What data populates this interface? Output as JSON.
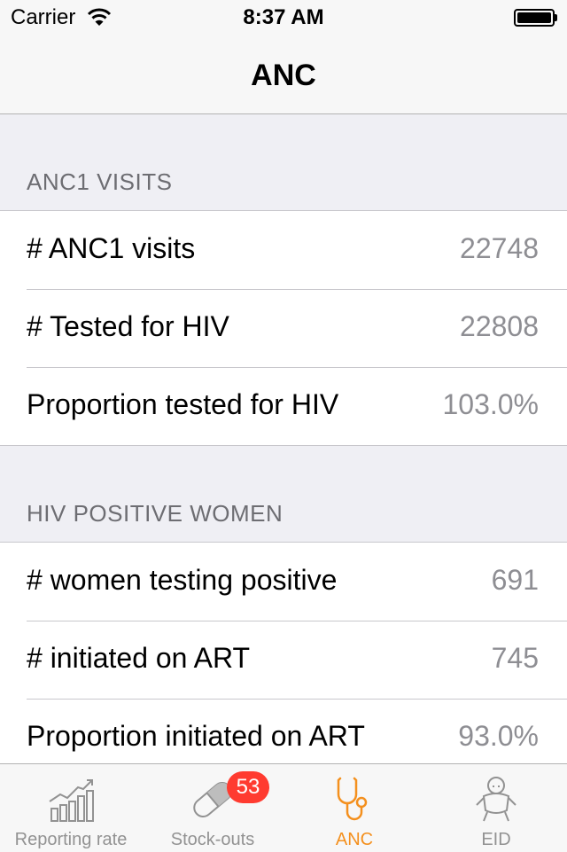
{
  "status_bar": {
    "carrier": "Carrier",
    "time": "8:37 AM"
  },
  "nav": {
    "title": "ANC"
  },
  "sections": [
    {
      "header": "ANC1 VISITS",
      "rows": [
        {
          "label": "# ANC1 visits",
          "value": "22748"
        },
        {
          "label": "# Tested for HIV",
          "value": "22808"
        },
        {
          "label": "Proportion tested for HIV",
          "value": "103.0%"
        }
      ]
    },
    {
      "header": "HIV POSITIVE WOMEN",
      "rows": [
        {
          "label": "# women testing positive",
          "value": "691"
        },
        {
          "label": "# initiated on ART",
          "value": "745"
        },
        {
          "label": "Proportion initiated on ART",
          "value": "93.0%"
        }
      ]
    }
  ],
  "tabs": [
    {
      "label": "Reporting rate",
      "icon": "bar-chart-trend-icon"
    },
    {
      "label": "Stock-outs",
      "icon": "pill-capsule-icon",
      "badge": "53"
    },
    {
      "label": "ANC",
      "icon": "stethoscope-icon",
      "active": true
    },
    {
      "label": "EID",
      "icon": "baby-icon"
    }
  ],
  "colors": {
    "accent": "#f4901e",
    "badge": "#ff3b30",
    "secondary_text": "#8e8e93"
  }
}
